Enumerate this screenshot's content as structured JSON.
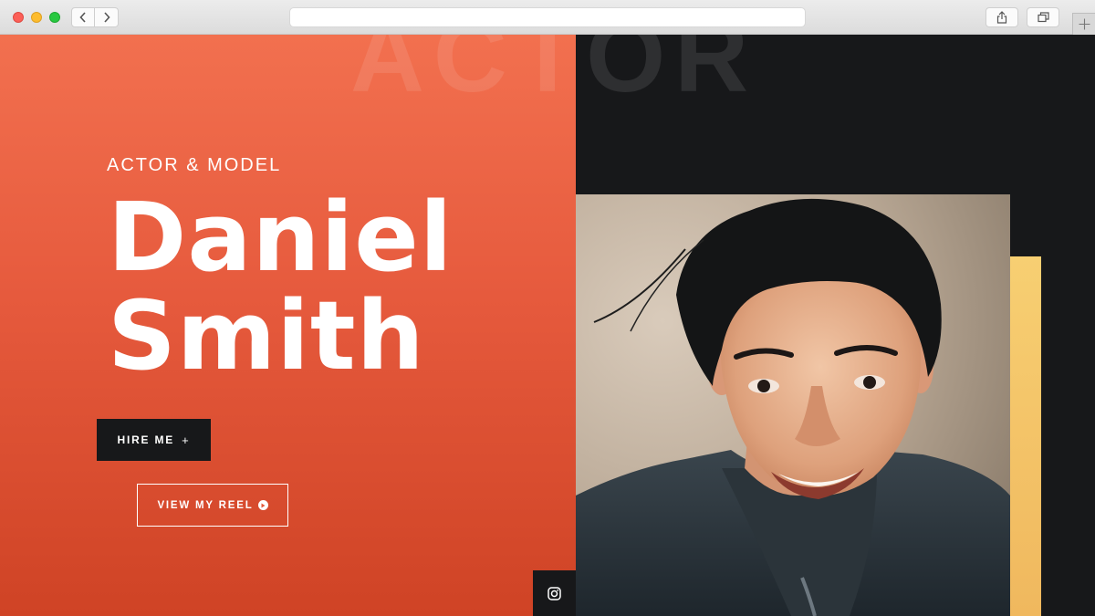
{
  "hero": {
    "background_word": "ACTOR",
    "subtitle": "ACTOR & MODEL",
    "first_name": "Daniel",
    "last_name": "Smith",
    "hire_label": "HIRE ME",
    "hire_icon": "+",
    "reel_label": "VIEW MY REEL"
  },
  "icons": {
    "reel": "play-circle-icon",
    "social": "instagram-icon"
  },
  "colors": {
    "accent_orange": "#e65a3d",
    "accent_yellow": "#f0b85e",
    "dark": "#17181a"
  }
}
